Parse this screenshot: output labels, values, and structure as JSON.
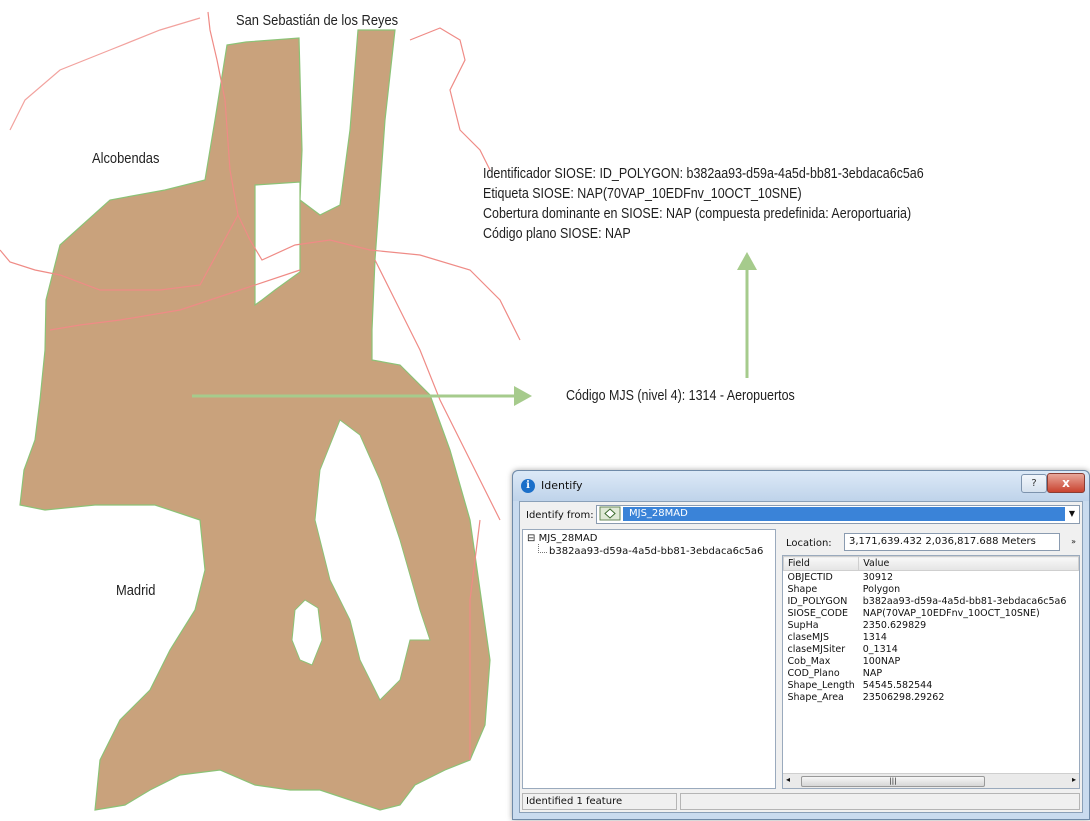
{
  "map": {
    "labels": {
      "san_sebastian": "San Sebastián de los Reyes",
      "alcobendas": "Alcobendas",
      "madrid": "Madrid"
    },
    "info_lines": [
      "Identificador SIOSE: ID_POLYGON: b382aa93-d59a-4a5d-bb81-3ebdaca6c5a6",
      "Etiqueta SIOSE: NAP(70VAP_10EDFnv_10OCT_10SNE)",
      "Cobertura dominante en SIOSE: NAP (compuesta predefinida: Aeroportuaria)",
      "Código plano SIOSE: NAP"
    ],
    "mjs_label": "Código MJS (nivel 4): 1314 - Aeropuertos",
    "colors": {
      "polygon_fill": "#c9a27c",
      "polygon_outline": "#8cc276",
      "boundary": "#ef8b86",
      "arrow": "#a6cb8c"
    }
  },
  "identify": {
    "title": "Identify",
    "help": "?",
    "close": "x",
    "identify_from_label": "Identify from:",
    "identify_from_value": "MJS_28MAD",
    "tree_root": "MJS_28MAD",
    "tree_child": "b382aa93-d59a-4a5d-bb81-3ebdaca6c5a6",
    "location_label": "Location:",
    "location_value": "3,171,639.432  2,036,817.688 Meters",
    "location_extra": "»",
    "columns": [
      "Field",
      "Value"
    ],
    "rows": [
      {
        "field": "OBJECTID",
        "value": "30912"
      },
      {
        "field": "Shape",
        "value": "Polygon"
      },
      {
        "field": "ID_POLYGON",
        "value": "b382aa93-d59a-4a5d-bb81-3ebdaca6c5a6"
      },
      {
        "field": "SIOSE_CODE",
        "value": "NAP(70VAP_10EDFnv_10OCT_10SNE)"
      },
      {
        "field": "SupHa",
        "value": "2350.629829"
      },
      {
        "field": "claseMJS",
        "value": "1314"
      },
      {
        "field": "claseMJSiter",
        "value": "0_1314"
      },
      {
        "field": "Cob_Max",
        "value": "100NAP"
      },
      {
        "field": "COD_Plano",
        "value": "NAP"
      },
      {
        "field": "Shape_Length",
        "value": "54545.582544"
      },
      {
        "field": "Shape_Area",
        "value": "23506298.29262"
      }
    ],
    "status": "Identified 1 feature"
  }
}
